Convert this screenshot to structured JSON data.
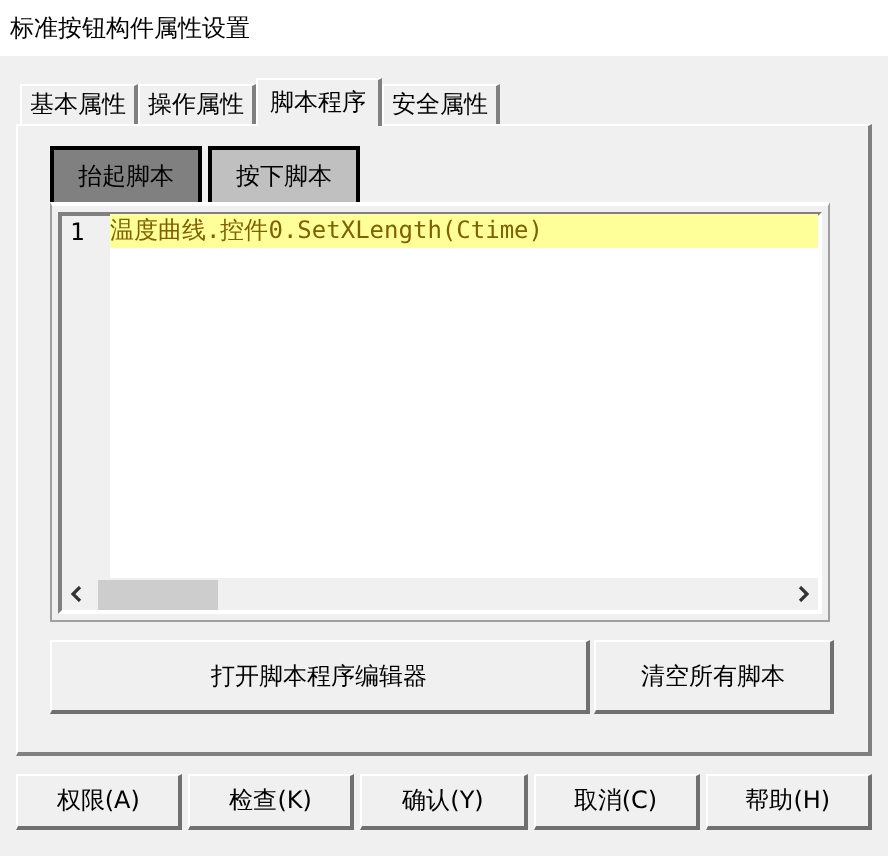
{
  "window": {
    "title": "标准按钮构件属性设置"
  },
  "tabs": [
    {
      "label": "基本属性",
      "selected": false
    },
    {
      "label": "操作属性",
      "selected": false
    },
    {
      "label": "脚本程序",
      "selected": true
    },
    {
      "label": "安全属性",
      "selected": false
    }
  ],
  "script_tabs": [
    {
      "label": "抬起脚本",
      "selected": true
    },
    {
      "label": "按下脚本",
      "selected": false
    }
  ],
  "editor": {
    "lines": [
      {
        "number": "1",
        "text": "温度曲线.控件0.SetXLength(Ctime)",
        "current": true
      }
    ]
  },
  "panel_buttons": [
    "打开脚本程序编辑器",
    "清空所有脚本"
  ],
  "buttons": [
    "权限(A)",
    "检查(K)",
    "确认(Y)",
    "取消(C)",
    "帮助(H)"
  ]
}
